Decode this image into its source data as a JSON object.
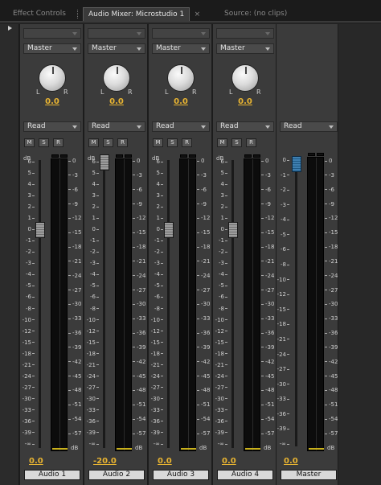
{
  "tabs": [
    {
      "label": "Effect Controls",
      "active": false
    },
    {
      "label": "Audio Mixer: Microstudio 1",
      "active": true
    },
    {
      "label": "Source: (no clips)",
      "active": false
    }
  ],
  "close_glyph": "×",
  "pan": {
    "left": "L",
    "right": "R"
  },
  "msr_buttons": [
    "M",
    "S",
    "R"
  ],
  "db_unit": "dB",
  "fader_scale": [
    "6",
    "5",
    "4",
    "3",
    "2",
    "1",
    "0",
    "-1",
    "-2",
    "-3",
    "-4",
    "-5",
    "-6",
    "-8",
    "-10",
    "-12",
    "-15",
    "-18",
    "-21",
    "-24",
    "-27",
    "-30",
    "-33",
    "-36",
    "-39",
    "-∞"
  ],
  "master_fader_scale": [
    "0",
    "-1",
    "-2",
    "-3",
    "-4",
    "-5",
    "-6",
    "-8",
    "-10",
    "-12",
    "-15",
    "-18",
    "-21",
    "-24",
    "-27",
    "-30",
    "-33",
    "-36",
    "-39",
    "-∞"
  ],
  "meter_scale": [
    "0",
    "-3",
    "-6",
    "-9",
    "-12",
    "-15",
    "-18",
    "-21",
    "-24",
    "-27",
    "-30",
    "-33",
    "-36",
    "-39",
    "-42",
    "-45",
    "-48",
    "-51",
    "-54",
    "-57"
  ],
  "meter_floor_label": "dB",
  "tracks": [
    {
      "name": "Audio 1",
      "output": "Master",
      "automation": "Read",
      "pan_value": "0.0",
      "volume": "0.0",
      "volume_db": 0
    },
    {
      "name": "Audio 2",
      "output": "Master",
      "automation": "Read",
      "pan_value": "0.0",
      "volume": "-20.0",
      "volume_db": -20
    },
    {
      "name": "Audio 3",
      "output": "Master",
      "automation": "Read",
      "pan_value": "0.0",
      "volume": "0.0",
      "volume_db": 0
    },
    {
      "name": "Audio 4",
      "output": "Master",
      "automation": "Read",
      "pan_value": "0.0",
      "volume": "0.0",
      "volume_db": 0
    }
  ],
  "master": {
    "name": "Master",
    "automation": "Read",
    "volume": "0.0",
    "volume_db": 0
  },
  "colors": {
    "value_accent": "#e8b432",
    "master_fader": "#3f7fb0",
    "meter_floor": "#c9b11c"
  },
  "icons": {
    "panel_menu": "triangle-right-icon",
    "dropdown": "chevron-down-icon",
    "pan_knob": "knob-icon"
  }
}
